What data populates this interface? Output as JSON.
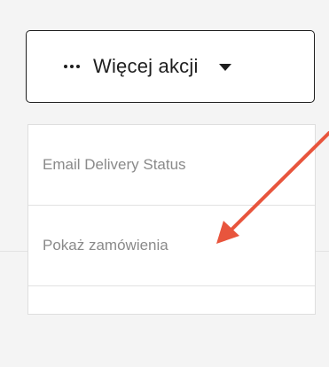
{
  "more_actions": {
    "label": "Więcej akcji",
    "icon_left": "more-dots-icon",
    "icon_right": "caret-down-icon"
  },
  "menu": {
    "items": [
      {
        "label": "Email Delivery Status"
      },
      {
        "label": "Pokaż zamówienia"
      },
      {
        "label": ""
      }
    ]
  },
  "annotation": {
    "color": "#e8553d",
    "icon": "red-arrow"
  }
}
